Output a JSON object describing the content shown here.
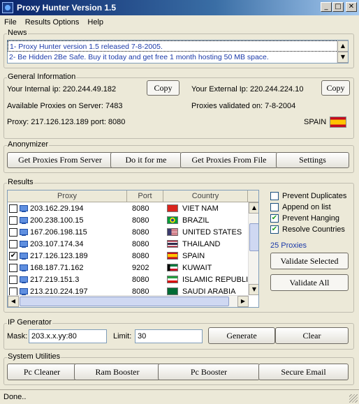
{
  "window": {
    "title": "Proxy Hunter Version 1.5"
  },
  "menu": [
    "File",
    "Results Options",
    "Help"
  ],
  "news": {
    "legend": "News",
    "lines": [
      "1- Proxy Hunter version 1.5 released 7-8-2005.",
      "2- Be Hidden 2Be Safe. Buy it today and get free 1 month hosting 50 MB space."
    ]
  },
  "general": {
    "legend": "General Information",
    "internal_ip": "Your Internal ip: 220.244.49.182",
    "external_ip": "Your External Ip: 220.244.224.10",
    "copy_label": "Copy",
    "available": "Available Proxies on Server: 7483",
    "validated_on": "Proxies validated on: 7-8-2004",
    "proxy": "Proxy: 217.126.123.189 port: 8080",
    "country": "SPAIN"
  },
  "anonymizer": {
    "legend": "Anonymizer",
    "buttons": [
      "Get Proxies From Server",
      "Do it for me",
      "Get Proxies From File",
      "Settings"
    ]
  },
  "results": {
    "legend": "Results",
    "columns": [
      "Proxy",
      "Port",
      "Country"
    ],
    "rows": [
      {
        "ip": "203.162.29.194",
        "port": "8080",
        "country": "VIET NAM",
        "checked": false,
        "flag": "vn"
      },
      {
        "ip": "200.238.100.15",
        "port": "8080",
        "country": "BRAZIL",
        "checked": false,
        "flag": "br"
      },
      {
        "ip": "167.206.198.115",
        "port": "8080",
        "country": "UNITED STATES",
        "checked": false,
        "flag": "us"
      },
      {
        "ip": "203.107.174.34",
        "port": "8080",
        "country": "THAILAND",
        "checked": false,
        "flag": "th"
      },
      {
        "ip": "217.126.123.189",
        "port": "8080",
        "country": "SPAIN",
        "checked": true,
        "flag": "es"
      },
      {
        "ip": "168.187.71.162",
        "port": "9202",
        "country": "KUWAIT",
        "checked": false,
        "flag": "kw"
      },
      {
        "ip": "217.219.151.3",
        "port": "8080",
        "country": "ISLAMIC REPUBLIC",
        "checked": false,
        "flag": "ir"
      },
      {
        "ip": "213.210.224.197",
        "port": "8080",
        "country": "SAUDI ARABIA",
        "checked": false,
        "flag": "sa"
      }
    ],
    "options": [
      {
        "label": "Prevent Duplicates",
        "checked": false
      },
      {
        "label": "Append on list",
        "checked": false
      },
      {
        "label": "Prevent Hanging",
        "checked": true
      },
      {
        "label": "Resolve Countries",
        "checked": true
      }
    ],
    "count": "25 Proxies",
    "validate_selected": "Validate Selected",
    "validate_all": "Validate All"
  },
  "ipgen": {
    "legend": "IP Generator",
    "mask_label": "Mask:",
    "mask_value": "203.x.x.yy:80",
    "limit_label": "Limit:",
    "limit_value": "30",
    "generate": "Generate",
    "clear": "Clear"
  },
  "system": {
    "legend": "System Utilities",
    "buttons": [
      "Pc Cleaner",
      "Ram Booster",
      "Pc Booster",
      "Secure Email"
    ]
  },
  "status": "Done..",
  "colors": {
    "title_start": "#0a246a",
    "title_end": "#a6caf0",
    "news_text": "#1c3aa9",
    "proxies_count": "#1c3aa9"
  }
}
